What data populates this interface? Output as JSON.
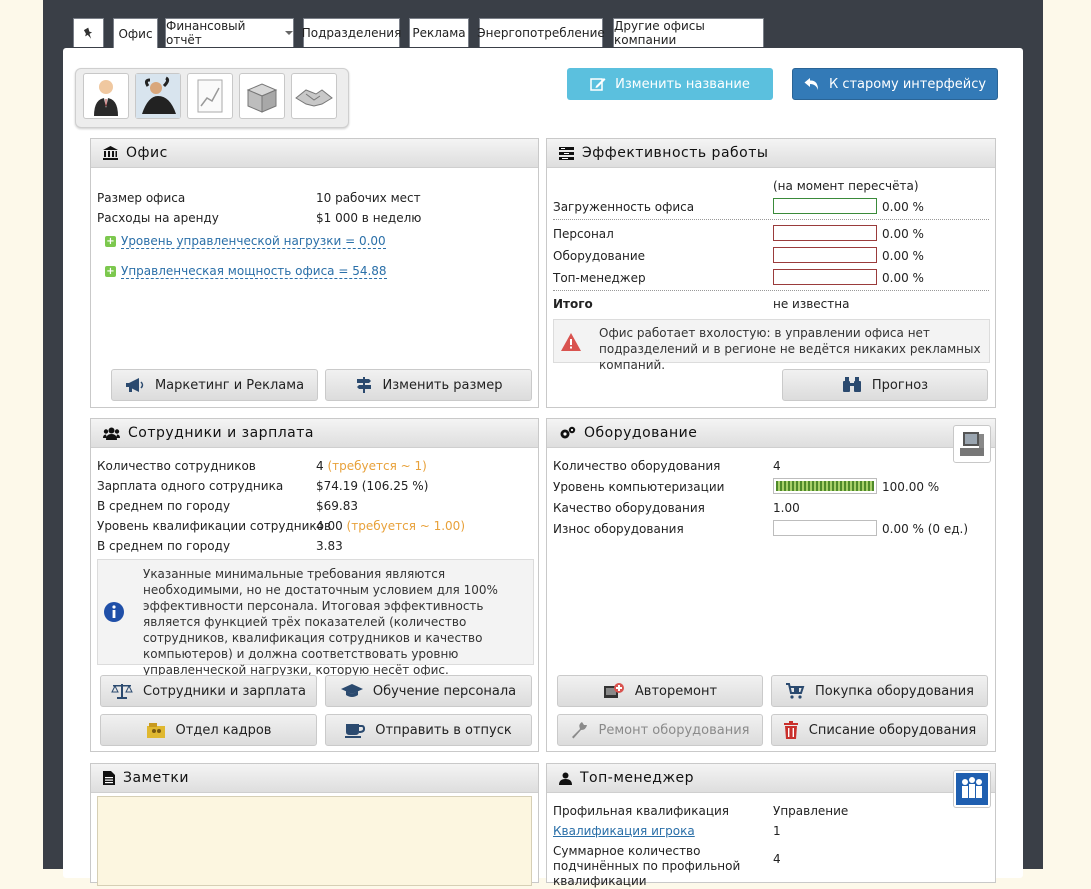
{
  "tabs": [
    {
      "label": ""
    },
    {
      "label": "Офис"
    },
    {
      "label": "Финансовый отчёт"
    },
    {
      "label": "Подразделения"
    },
    {
      "label": "Реклама"
    },
    {
      "label": "Энергопотребление"
    },
    {
      "label": "Другие офисы компании"
    }
  ],
  "top_buttons": {
    "rename": "Изменить название",
    "old_ui": "К старому интерфейсу"
  },
  "colors": {
    "rename_bg": "#5bc0de",
    "old_ui_bg": "#337ab7",
    "frame": "#3a3f47",
    "page_bg": "#fdf9ea",
    "bar_green": "#3a8a3a",
    "bar_red": "#9a3b3b"
  },
  "office": {
    "title": "Офис",
    "size_label": "Размер офиса",
    "size_value": "10 рабочих мест",
    "rent_label": "Расходы на аренду",
    "rent_value": "$1 000 в неделю",
    "load_link": "Уровень управленческой нагрузки = 0.00",
    "power_link": "Управленческая мощность офиса = 54.88",
    "btn_marketing": "Маркетинг и Реклама",
    "btn_resize": "Изменить размер"
  },
  "efficiency": {
    "title": "Эффективность работы",
    "note": "(на момент пересчёта)",
    "load_label": "Загруженность офиса",
    "load_value": "0.00 %",
    "load_pct": 0,
    "staff_label": "Персонал",
    "staff_value": "0.00 %",
    "staff_pct": 0,
    "equip_label": "Оборудование",
    "equip_value": "0.00 %",
    "equip_pct": 0,
    "manager_label": "Топ-менеджер",
    "manager_value": "0.00 %",
    "manager_pct": 0,
    "total_label": "Итого",
    "total_value": "не известна",
    "warning": "Офис работает вхолостую: в управлении офиса нет подразделений и в регионе не ведётся никаких рекламных компаний.",
    "btn_forecast": "Прогноз"
  },
  "staff": {
    "title": "Сотрудники и зарплата",
    "count_label": "Количество сотрудников",
    "count_value": "4",
    "count_req": "(требуется ~ 1)",
    "salary_label": "Зарплата одного сотрудника",
    "salary_value": "$74.19 (106.25 %)",
    "city_avg_label": "В среднем по городу",
    "city_avg_value": "$69.83",
    "qual_label": "Уровень квалификации сотрудников",
    "qual_value": "4.00",
    "qual_req": "(требуется ~ 1.00)",
    "city_qual_label": "В среднем по городу",
    "city_qual_value": "3.83",
    "info": "Указанные минимальные требования являются необходимыми, но не достаточным условием для 100% эффективности персонала. Итоговая эффективность является функцией трёх показателей (количество сотрудников, квалификация сотрудников и качество компьютеров) и должна соответствовать уровню управленческой нагрузки, которую несёт офис.",
    "btn_salary": "Сотрудники и зарплата",
    "btn_training": "Обучение персонала",
    "btn_hr": "Отдел кадров",
    "btn_vacation": "Отправить в отпуск"
  },
  "equipment": {
    "title": "Оборудование",
    "count_label": "Количество оборудования",
    "count_value": "4",
    "comp_label": "Уровень компьютеризации",
    "comp_value": "100.00 %",
    "comp_pct": 100,
    "quality_label": "Качество оборудования",
    "quality_value": "1.00",
    "wear_label": "Износ оборудования",
    "wear_value": "0.00 % (0 ед.)",
    "wear_pct": 0,
    "btn_autorepair": "Авторемонт",
    "btn_buy": "Покупка оборудования",
    "btn_repair": "Ремонт оборудования",
    "btn_writeoff": "Списание оборудования"
  },
  "notes": {
    "title": "Заметки"
  },
  "top_manager": {
    "title": "Топ-менеджер",
    "prof_label": "Профильная квалификация",
    "prof_value": "Управление",
    "player_label": "Квалификация игрока",
    "player_value": "1",
    "subord_label": "Суммарное количество подчинённых по профильной квалификации",
    "subord_value": "4"
  }
}
